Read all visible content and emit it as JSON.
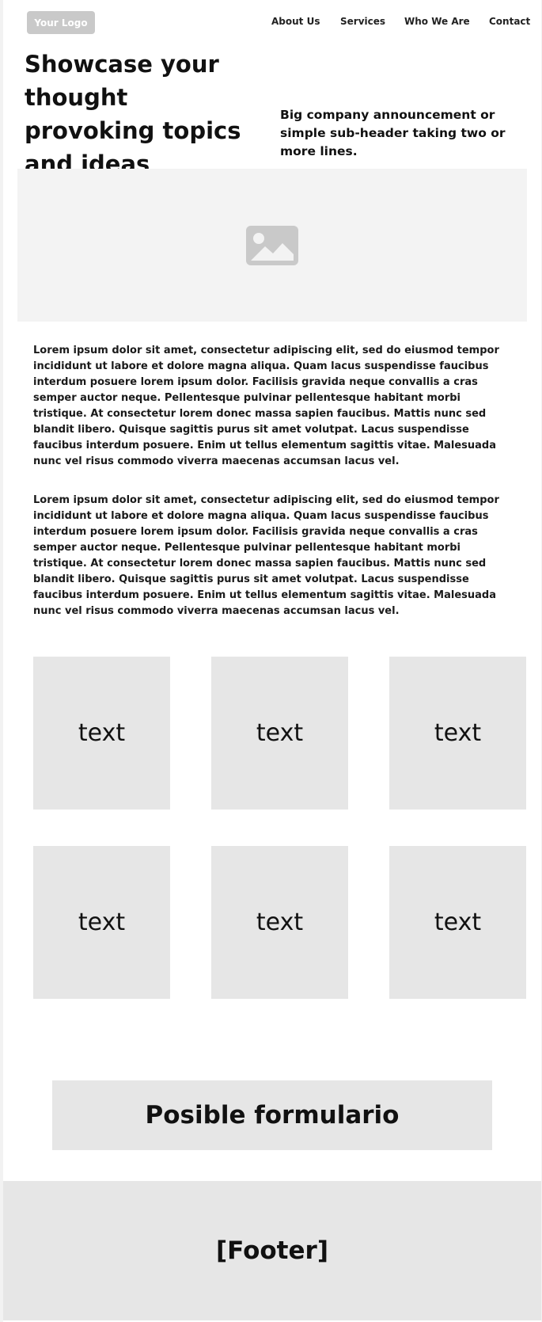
{
  "header": {
    "logo_text": "Your Logo",
    "nav": [
      "About Us",
      "Services",
      "Who We Are",
      "Contact"
    ]
  },
  "hero": {
    "title": "Showcase your thought provoking topics and ideas",
    "subheader": "Big company announcement or simple sub-header taking two or more lines.",
    "image_icon": "image-placeholder-icon"
  },
  "paragraphs": [
    "Lorem ipsum dolor sit amet, consectetur adipiscing elit, sed do eiusmod tempor incididunt ut labore et dolore magna aliqua. Quam lacus suspendisse faucibus interdum posuere lorem ipsum dolor. Facilisis gravida neque convallis a cras semper auctor neque. Pellentesque pulvinar pellentesque habitant morbi tristique. At consectetur lorem donec massa sapien faucibus. Mattis nunc sed blandit libero. Quisque sagittis purus sit amet volutpat. Lacus suspendisse faucibus interdum posuere. Enim ut tellus elementum sagittis vitae. Malesuada nunc vel risus commodo viverra maecenas accumsan lacus vel.",
    "Lorem ipsum dolor sit amet, consectetur adipiscing elit, sed do eiusmod tempor incididunt ut labore et dolore magna aliqua. Quam lacus suspendisse faucibus interdum posuere lorem ipsum dolor. Facilisis gravida neque convallis a cras semper auctor neque. Pellentesque pulvinar pellentesque habitant morbi tristique. At consectetur lorem donec massa sapien faucibus. Mattis nunc sed blandit libero. Quisque sagittis purus sit amet volutpat. Lacus suspendisse faucibus interdum posuere. Enim ut tellus elementum sagittis vitae. Malesuada nunc vel risus commodo viverra maecenas accumsan lacus vel."
  ],
  "cards": [
    "text",
    "text",
    "text",
    "text",
    "text",
    "text"
  ],
  "form_placeholder": "Posible formulario",
  "footer_text": "[Footer]",
  "colors": {
    "background": "#ffffff",
    "canvas": "#f2f2f2",
    "placeholder_gray": "#e6e6e6",
    "image_bg": "#f3f3f3",
    "logo_bg": "#c9c9c9",
    "text": "#111111"
  }
}
